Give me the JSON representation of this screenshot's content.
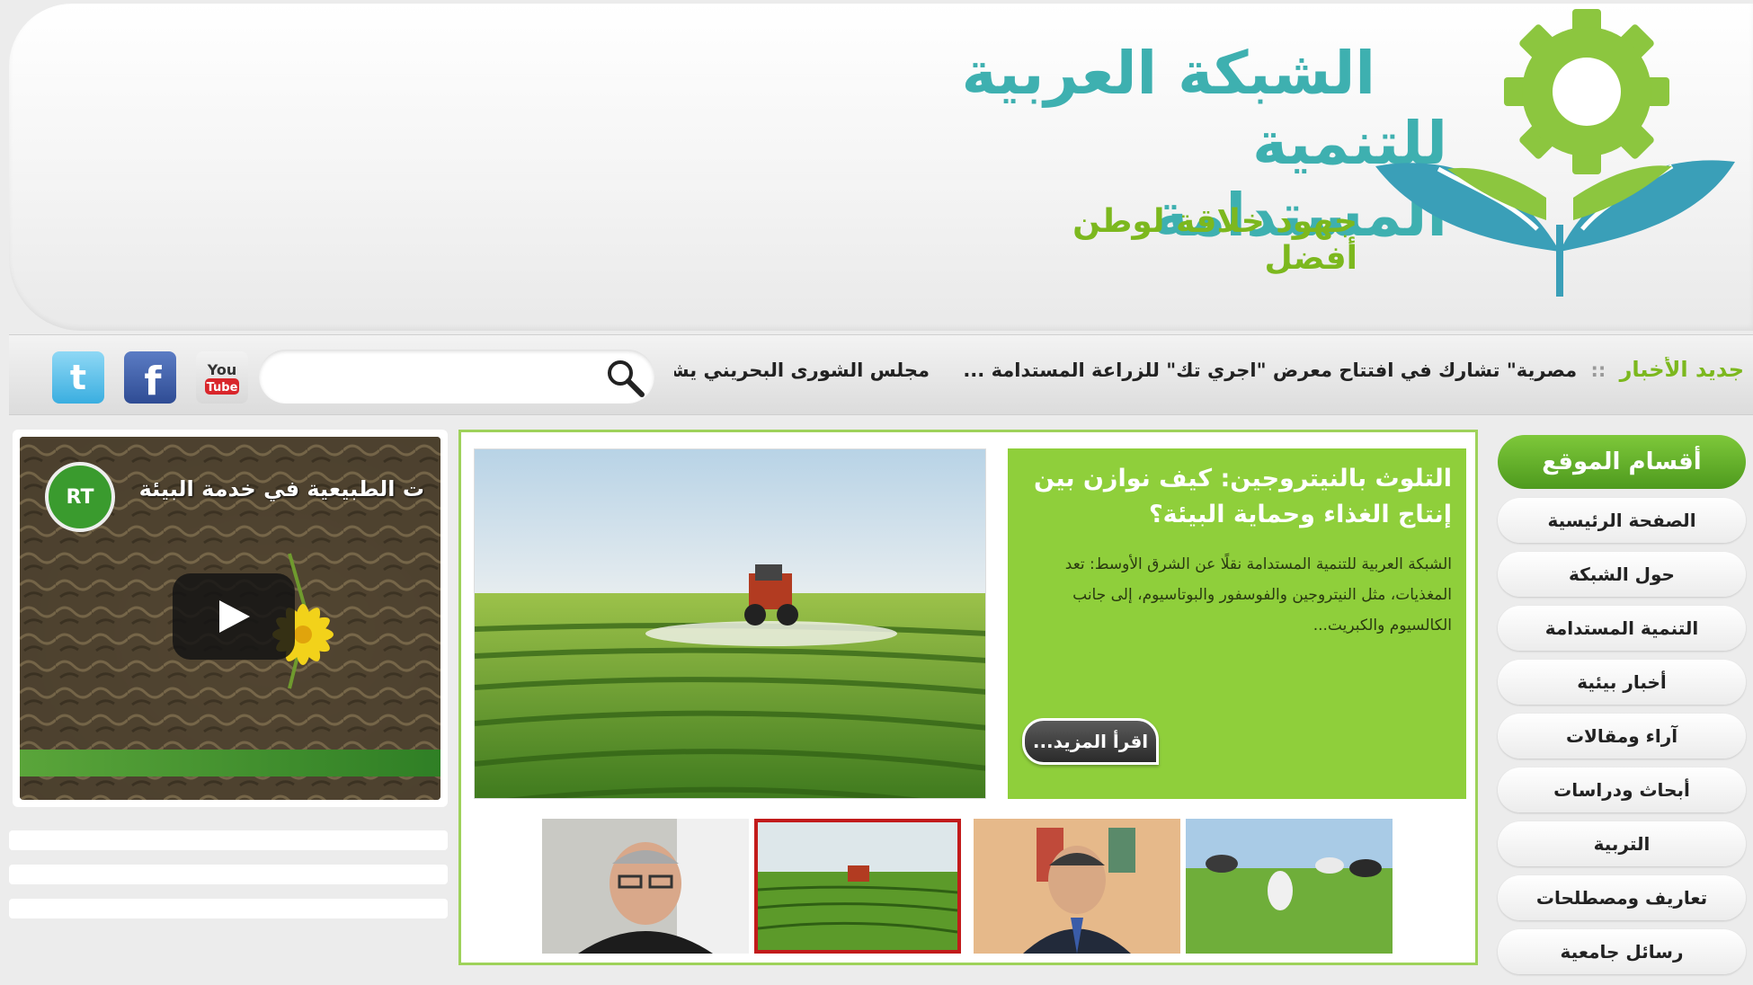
{
  "header": {
    "brand_line1": "الشبكة العربية",
    "brand_line2": "للتنمية المستدامة",
    "slogan": "جهود خلاقة لوطن أفضل"
  },
  "colors": {
    "brand_teal": "#3eb0b0",
    "brand_green": "#7cb81e",
    "panel_green": "#8fcf3b",
    "active_thumb_border": "#c21b1b"
  },
  "social": {
    "icons": [
      "twitter-icon",
      "facebook-icon",
      "youtube-icon"
    ]
  },
  "search": {
    "placeholder": ""
  },
  "ticker": {
    "label": "جديد الأخبار",
    "separator": "::",
    "items": [
      "مصرية\" تشارك في افتتاح معرض \"اجري تك\" للزراعة المستدامة ...",
      "مجلس الشورى البحريني يشارك في"
    ]
  },
  "video": {
    "channel_badge": "RT",
    "title": "ت الطبيعية في خدمة البيئة"
  },
  "featured": {
    "title": "التلوث بالنيتروجين: كيف نوازن بين إنتاج الغذاء وحماية البيئة؟",
    "text": "الشبكة العربية للتنمية المستدامة نقلًا عن الشرق الأوسط: تعد المغذيات، مثل النيتروجين والفوسفور والبوتاسيوم، إلى جانب الكالسيوم والكبريت...",
    "read_more": "اقرأ المزيد..."
  },
  "sidebar": {
    "heading": "أقسام الموقع",
    "items": [
      "الصفحة الرئيسية",
      "حول الشبكة",
      "التنمية المستدامة",
      "أخبار بيئية",
      "آراء ومقالات",
      "أبحاث ودراسات",
      "التربية",
      "تعاريف ومصطلحات",
      "رسائل جامعية"
    ]
  }
}
